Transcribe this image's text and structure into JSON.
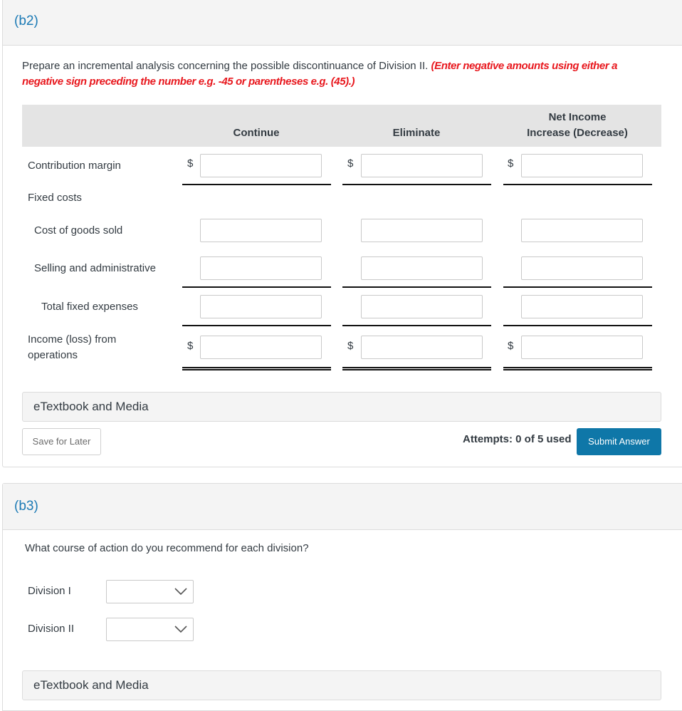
{
  "part_b2": {
    "label": "(b2)",
    "instruction_text": "Prepare an incremental analysis concerning the possible discontinuance of Division II.",
    "instruction_note": "(Enter negative amounts using either a negative sign preceding the number e.g. -45 or parentheses e.g. (45).)",
    "table": {
      "columns": [
        "Continue",
        "Eliminate"
      ],
      "net_column_line1": "Net Income",
      "net_column_line2": "Increase (Decrease)",
      "currency_symbol": "$",
      "rows": [
        {
          "label": "Contribution margin",
          "values": [
            "",
            "",
            ""
          ],
          "has_dollar": true
        },
        {
          "label": "Fixed costs",
          "is_heading": true
        },
        {
          "label": "Cost of goods sold",
          "values": [
            "",
            "",
            ""
          ]
        },
        {
          "label": "Selling and administrative",
          "values": [
            "",
            "",
            ""
          ]
        },
        {
          "label": "Total fixed expenses",
          "values": [
            "",
            "",
            ""
          ]
        },
        {
          "label_line1": "Income (loss) from",
          "label_line2": "operations",
          "values": [
            "",
            "",
            ""
          ],
          "has_dollar": true
        }
      ]
    },
    "etextbook_label": "eTextbook and Media",
    "save_label": "Save for Later",
    "attempts_text": "Attempts: 0 of 5 used",
    "submit_label": "Submit Answer"
  },
  "part_b3": {
    "label": "(b3)",
    "question": "What course of action do you recommend for each division?",
    "selects": [
      {
        "label": "Division I",
        "value": ""
      },
      {
        "label": "Division II",
        "value": ""
      }
    ],
    "etextbook_label": "eTextbook and Media"
  },
  "colors": {
    "part_label": "#1b7ab5",
    "warning_text": "#e8181e",
    "submit_button": "#0f77a8",
    "table_header_bg": "#e4e4e4",
    "panel_header_bg": "#f4f4f4"
  }
}
